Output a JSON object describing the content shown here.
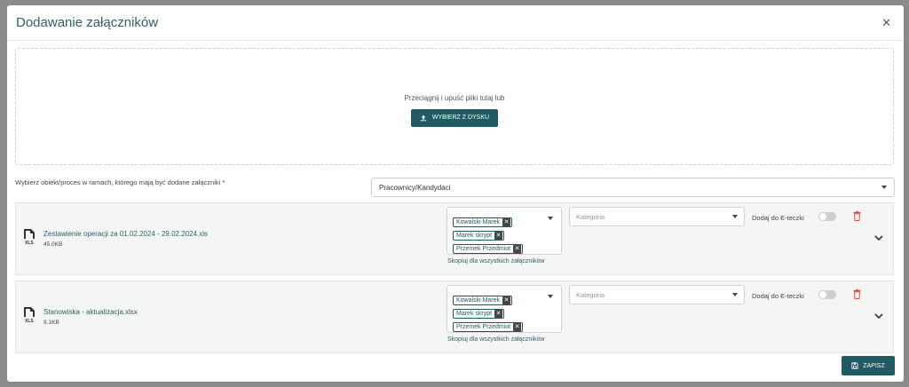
{
  "modal": {
    "title": "Dodawanie załączników"
  },
  "dropzone": {
    "text": "Przeciągnij i upuść pliki tutaj lub",
    "button_label": "WYBIERZ Z DYSKU"
  },
  "object_select": {
    "label": "Wybierz obiekt/proces w ramach, którego mają być dodane załączniki *",
    "value": "Pracownicy/Kandydaci"
  },
  "files": [
    {
      "name": "Zestawienie operacji za 01.02.2024 - 29.02.2024.xls",
      "size": "45.0KB",
      "tags": [
        "Kowalski Marek",
        "Marek skrypt",
        "Przemek Przedmiot"
      ],
      "copy_label": "Skopiuj dla wszystkich załączników",
      "category_placeholder": "Kategoria",
      "eteczki_label": "Dodaj do E-teczki",
      "eteczki_enabled": false
    },
    {
      "name": "Stanowiska - aktualizacja.xlsx",
      "size": "9.1KB",
      "tags": [
        "Kowalski Marek",
        "Marek skrypt",
        "Przemek Przedmiot"
      ],
      "copy_label": "Skopiuj dla wszystkich załączników",
      "category_placeholder": "Kategoria",
      "eteczki_label": "Dodaj do E-teczki",
      "eteczki_enabled": false
    }
  ],
  "footer": {
    "save_label": "ZAPISZ"
  },
  "colors": {
    "accent": "#205a63",
    "title": "#2f5f68",
    "delete": "#e74c3c"
  }
}
